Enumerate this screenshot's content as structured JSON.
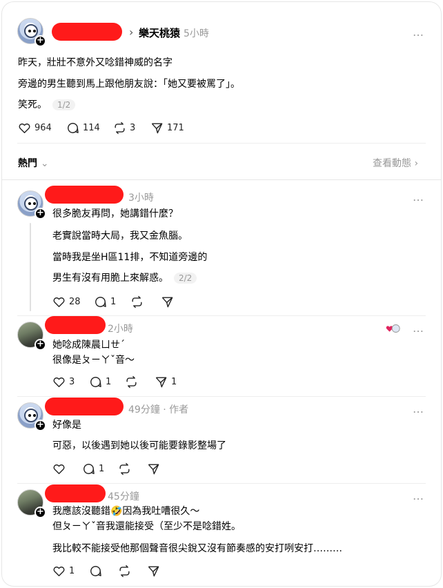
{
  "post": {
    "breadcrumb_separator": "›",
    "topic": "樂天桃猿",
    "time": "5小時",
    "lines": [
      "昨天，壯壯不意外又唸錯神威的名字",
      "旁邊的男生聽到馬上跟他朋友說：「她又要被罵了」。",
      "笑死。"
    ],
    "page_indicator": "1/2",
    "likes": "964",
    "comments": "114",
    "reposts": "3",
    "shares": "171"
  },
  "sort": {
    "label": "熱門",
    "view_activity": "查看動態"
  },
  "replies": [
    {
      "time": "3小時",
      "lines": [
        "很多脆友再問，她講錯什麼？",
        "老實說當時大局，我又金魚腦。",
        "當時我是坐H區11排，不知道旁邊的",
        "男生有沒有用脆上來解惑。"
      ],
      "page_indicator": "2/2",
      "likes": "28",
      "comments": "1"
    },
    {
      "time": "2小時",
      "lines": [
        "她唸成陳晨ㄩㄝˊ",
        "很像是ㄆㄧㄚˇ音～"
      ],
      "likes": "3",
      "comments": "1",
      "shares": "1"
    },
    {
      "time": "49分鐘 · 作者",
      "lines": [
        "好像是",
        "可惡，以後遇到她以後可能要錄影整場了"
      ],
      "comments": "1"
    },
    {
      "time": "45分鐘",
      "lines": [
        "我應該沒聽錯🤣因為我吐嘈很久～",
        "但ㄆㄧㄚˇ音我還能接受（至少不是唸錯姓。",
        "我比較不能接受他那個聲音很尖銳又沒有節奏感的安打咧安打………"
      ],
      "likes": "1"
    }
  ],
  "colors": {
    "redaction": "#ff1a1a",
    "muted": "#999999",
    "heart": "#e0245e"
  },
  "icons": {
    "more": "…",
    "plus": "+",
    "chevron": "⌄",
    "chevron_right": "›"
  }
}
